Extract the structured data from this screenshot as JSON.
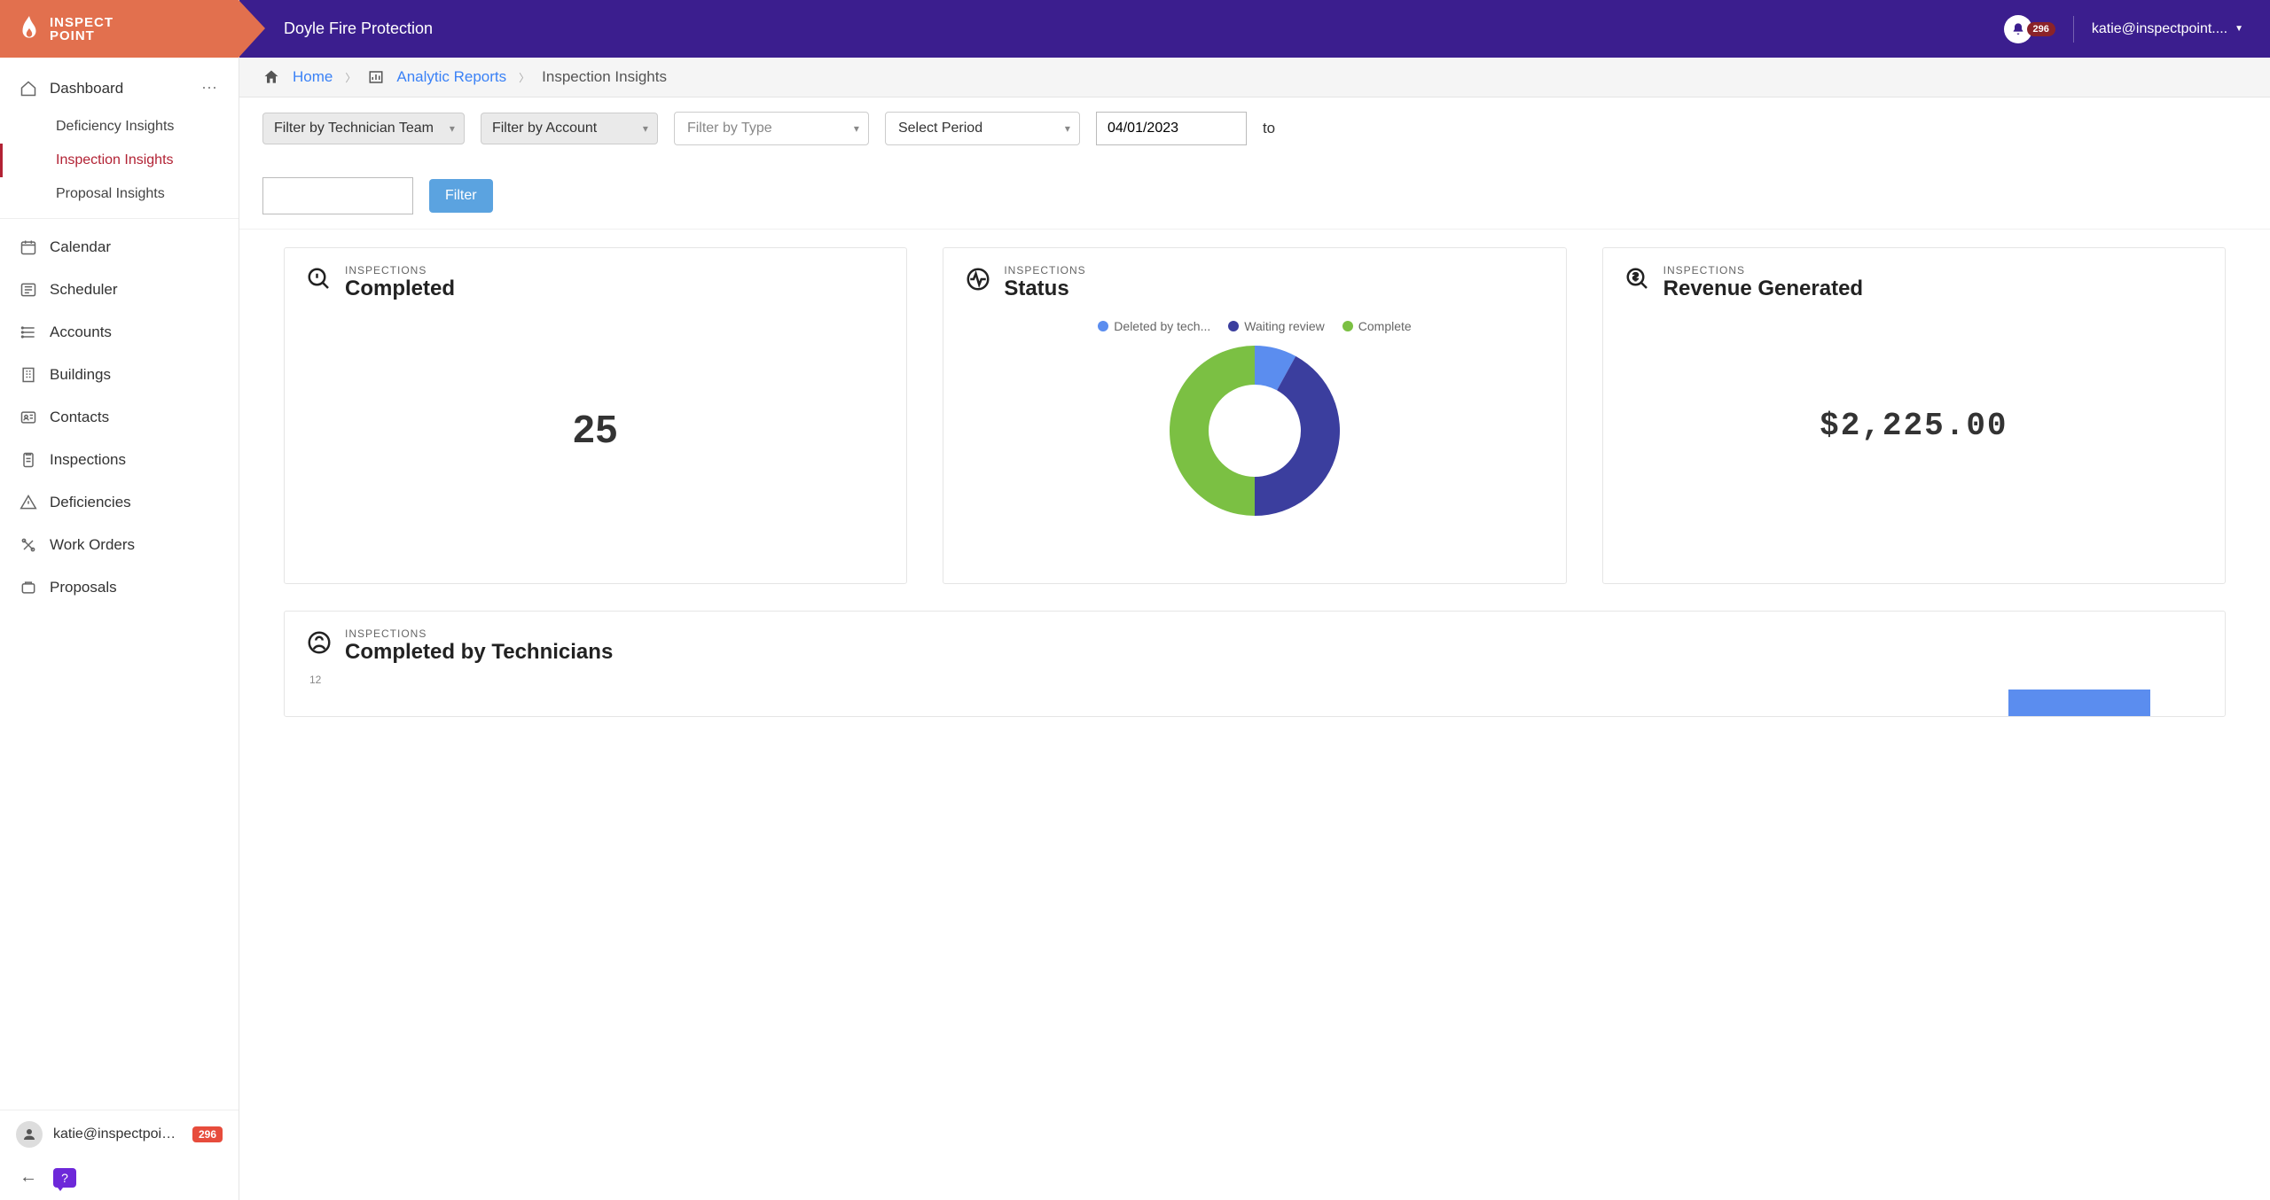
{
  "brand": {
    "name_line1": "INSPECT",
    "name_line2": "POINT"
  },
  "header": {
    "company": "Doyle Fire Protection",
    "notif_count": "296",
    "user_display": "katie@inspectpoint...."
  },
  "breadcrumb": {
    "home": "Home",
    "mid": "Analytic Reports",
    "current": "Inspection Insights"
  },
  "sidebar": {
    "dashboard": "Dashboard",
    "sub": [
      "Deficiency Insights",
      "Inspection Insights",
      "Proposal Insights"
    ],
    "items": [
      "Calendar",
      "Scheduler",
      "Accounts",
      "Buildings",
      "Contacts",
      "Inspections",
      "Deficiencies",
      "Work Orders",
      "Proposals"
    ],
    "footer_user": "katie@inspectpoint....",
    "footer_badge": "296"
  },
  "filters": {
    "team": "Filter by Technician Team",
    "account": "Filter by Account",
    "type": "Filter by Type",
    "period": "Select Period",
    "date_from": "04/01/2023",
    "to": "to",
    "button": "Filter"
  },
  "cards": {
    "sub": "INSPECTIONS",
    "completed_title": "Completed",
    "completed_value": "25",
    "status_title": "Status",
    "revenue_title": "Revenue Generated",
    "revenue_value": "$2,225.00",
    "tech_title": "Completed by Technicians",
    "axis_tick": "12"
  },
  "chart_data": {
    "type": "pie",
    "title": "Inspections Status",
    "series": [
      {
        "name": "Deleted by tech...",
        "value": 8,
        "color": "#5b8def"
      },
      {
        "name": "Waiting review",
        "value": 42,
        "color": "#3b3e9e"
      },
      {
        "name": "Complete",
        "value": 50,
        "color": "#7bc043"
      }
    ]
  }
}
